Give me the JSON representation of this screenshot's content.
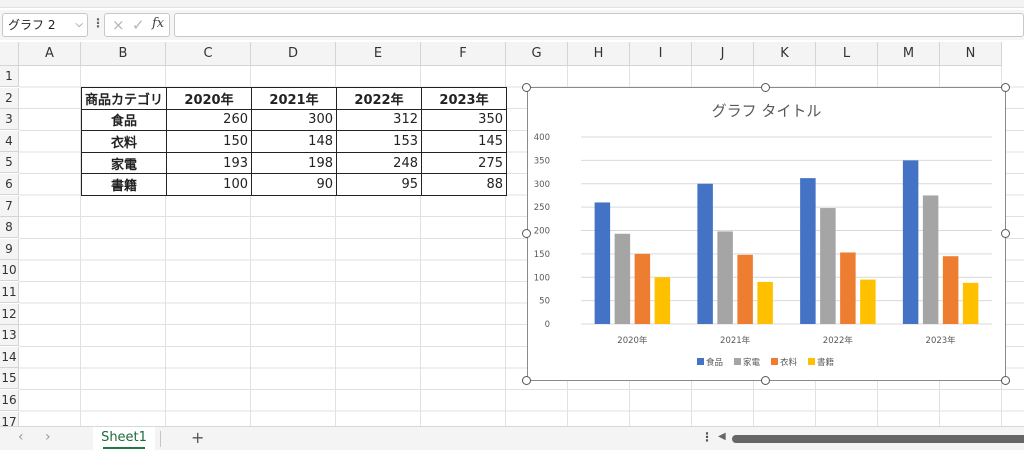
{
  "formula_bar": {
    "name_box": "グラフ 2",
    "cancel_icon": "×",
    "enter_icon": "✓",
    "fx_label": "fx",
    "formula": ""
  },
  "columns": [
    "A",
    "B",
    "C",
    "D",
    "E",
    "F",
    "G",
    "H",
    "I",
    "J",
    "K",
    "L",
    "M",
    "N"
  ],
  "rows": [
    "1",
    "2",
    "3",
    "4",
    "5",
    "6",
    "7",
    "8",
    "9",
    "10",
    "11",
    "12",
    "13",
    "14",
    "15",
    "16",
    "17"
  ],
  "table": {
    "header": [
      "商品カテゴリ",
      "2020年",
      "2021年",
      "2022年",
      "2023年"
    ],
    "rows": [
      {
        "category": "食品",
        "values": [
          "260",
          "300",
          "312",
          "350"
        ]
      },
      {
        "category": "衣料",
        "values": [
          "150",
          "148",
          "153",
          "145"
        ]
      },
      {
        "category": "家電",
        "values": [
          "193",
          "198",
          "248",
          "275"
        ]
      },
      {
        "category": "書籍",
        "values": [
          "100",
          "90",
          "95",
          "88"
        ]
      }
    ]
  },
  "chart_data": {
    "type": "bar",
    "title": "グラフ タイトル",
    "categories": [
      "2020年",
      "2021年",
      "2022年",
      "2023年"
    ],
    "series": [
      {
        "name": "食品",
        "values": [
          260,
          300,
          312,
          350
        ],
        "color": "#4472c4"
      },
      {
        "name": "家電",
        "values": [
          193,
          198,
          248,
          275
        ],
        "color": "#a5a5a5"
      },
      {
        "name": "衣料",
        "values": [
          150,
          148,
          153,
          145
        ],
        "color": "#ed7d31"
      },
      {
        "name": "書籍",
        "values": [
          100,
          90,
          95,
          88
        ],
        "color": "#ffc000"
      }
    ],
    "ylim": [
      0,
      400
    ],
    "yticks": [
      0,
      50,
      100,
      150,
      200,
      250,
      300,
      350,
      400
    ],
    "grid": true,
    "legend": "bottom"
  },
  "sheet_bar": {
    "prev_icon": "‹",
    "next_icon": "›",
    "sheet_tab": "Sheet1",
    "add_sheet": "+",
    "menu_dots": "⋮",
    "scroll_left_icon": "◀"
  }
}
